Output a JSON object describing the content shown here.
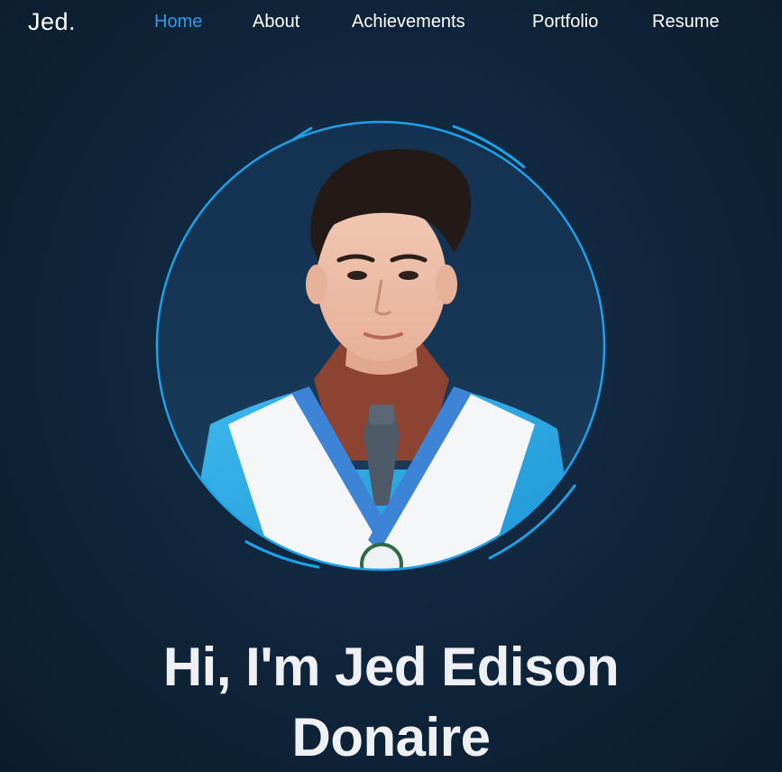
{
  "nav": {
    "brand": "Jed.",
    "links": [
      "Home",
      "About",
      "Achievements",
      "Portfolio",
      "Resume"
    ],
    "active": "Home"
  },
  "hero": {
    "title_line1": "Hi, I'm Jed Edison",
    "title_line2": "Donaire"
  },
  "colors": {
    "accent": "#2b9be8",
    "ring": "#1da1e8",
    "background": "#0d1f33",
    "text": "#eef0f4"
  },
  "icons": {
    "profile_photo": "graduate-portrait"
  }
}
